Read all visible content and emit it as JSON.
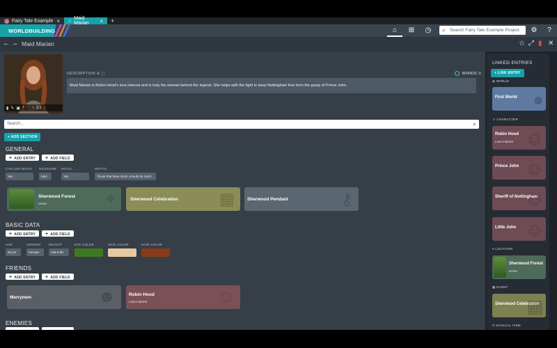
{
  "tabs": [
    {
      "label": "Fairy Tale Example",
      "close": "×"
    },
    {
      "label": "Maid Marian",
      "close": "×"
    }
  ],
  "tab_add": "+",
  "brand": "WORLDBUILDING",
  "search_top": {
    "placeholder": "Search Fairy Tale Example Project"
  },
  "entry": {
    "title": "Maid Marian"
  },
  "portrait": {
    "counter": "1/1"
  },
  "description": {
    "label": "DESCRIPTION",
    "words": "WORDS: 0",
    "text": "Maid Marian is Robin Hood's love interest and is truly the woman behind the legend. She helps with the fight to keep Nottingham free from the grasp of Prince John."
  },
  "page_search": {
    "placeholder": "Search..."
  },
  "add_section": "ADD SECTION",
  "add_entry": "ADD ENTRY",
  "add_field": "ADD FIELD",
  "general": {
    "title": "GENERAL",
    "fields": [
      {
        "label": "CAN USE MAGIC",
        "value": "Yes"
      },
      {
        "label": "NICKNAME",
        "value": "Mari"
      },
      {
        "label": "ROYAL ...",
        "value": "Yes"
      },
      {
        "label": "MOTTO",
        "value": "Those that have much, should do much"
      }
    ],
    "cards": [
      {
        "name": "Sherwood Forest",
        "sub": "Home",
        "color": "#4e6a5a"
      },
      {
        "name": "Sherwood Celebration",
        "sub": "",
        "color": "#8a8d55"
      },
      {
        "name": "Sherwood Pendant",
        "sub": "",
        "color": "#5b6770"
      }
    ]
  },
  "basic_data": {
    "title": "BASIC DATA",
    "fields": [
      {
        "label": "AGE",
        "value": "26 yrs"
      },
      {
        "label": "GENDER",
        "value": "Female"
      },
      {
        "label": "WEIGHT",
        "value": "135.5 lbs"
      }
    ],
    "colors": [
      {
        "label": "EYE COLOR",
        "value": "#3d7a1f"
      },
      {
        "label": "SKIN COLOR",
        "value": "#e8c8a0"
      },
      {
        "label": "HAIR COLOR",
        "value": "#8b3a1a"
      }
    ]
  },
  "friends": {
    "title": "FRIENDS",
    "cards": [
      {
        "name": "Merrymen",
        "sub": "",
        "color": "#5a5f66"
      },
      {
        "name": "Robin Hood",
        "sub": "Love Interest",
        "color": "#7a5158"
      }
    ]
  },
  "enemies": {
    "title": "ENEMIES"
  },
  "linked": {
    "title": "LINKED ENTRIES",
    "link_button": "LINK ENTRY",
    "groups": [
      {
        "head": "WORLD",
        "items": [
          {
            "name": "First World",
            "sub": "",
            "color": "#5f7aa0"
          }
        ]
      },
      {
        "head": "CHARACTER",
        "items": [
          {
            "name": "Robin Hood",
            "sub": "Love Interest",
            "color": "#6e4b55"
          },
          {
            "name": "Prince John",
            "sub": "",
            "color": "#6e4b55"
          },
          {
            "name": "Sheriff of Nottingham",
            "sub": "",
            "color": "#6e4b55"
          },
          {
            "name": "Little John",
            "sub": "",
            "color": "#6e4b55"
          }
        ]
      },
      {
        "head": "LOCATION",
        "items": [
          {
            "name": "Sherwood Forest",
            "sub": "Home",
            "color": "#4e6a5a"
          }
        ]
      },
      {
        "head": "EVENT",
        "items": [
          {
            "name": "Sherwood Celebration",
            "sub": "",
            "color": "#7d8050"
          }
        ]
      },
      {
        "head": "MAGICAL ITEM",
        "items": []
      }
    ]
  }
}
